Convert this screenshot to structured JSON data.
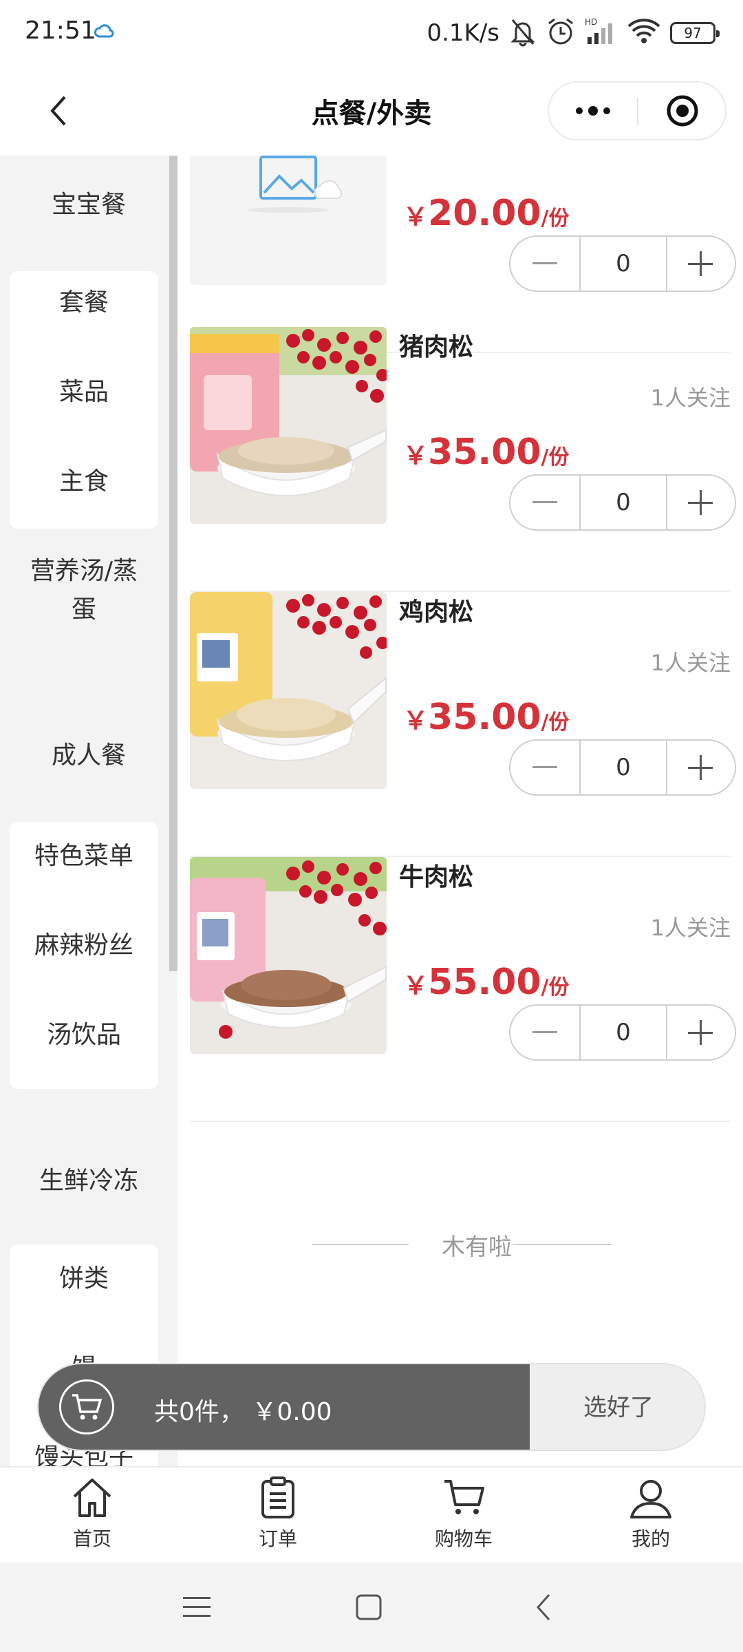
{
  "status_bar": {
    "time": "21:51",
    "net_speed": "0.1K/s",
    "battery": "97",
    "icons": [
      "cloud-sync-icon",
      "mute-bell-icon",
      "alarm-icon",
      "hd-signal-icon",
      "wifi-icon",
      "battery-icon"
    ]
  },
  "nav": {
    "title": "点餐/外卖",
    "back_icon": "chevron-left-icon",
    "more_icon": "more-dots-icon",
    "close_icon": "target-close-icon"
  },
  "sidebar": {
    "groups": [
      {
        "label": "宝宝餐",
        "items": [
          "套餐",
          "菜品",
          "主食",
          "营养汤/蒸蛋"
        ]
      },
      {
        "label": "成人餐",
        "items": [
          "特色菜单",
          "麻辣粉丝",
          "汤饮品"
        ]
      },
      {
        "label": "生鲜冷冻",
        "items": [
          "饼类",
          "馒",
          "馒头包子"
        ]
      }
    ]
  },
  "products": [
    {
      "name": "",
      "follow": "",
      "yen": "￥",
      "price": "20.00",
      "unit": "/份",
      "qty": "0",
      "image": "placeholder-image-icon"
    },
    {
      "name": "猪肉松",
      "follow": "1人关注",
      "yen": "￥",
      "price": "35.00",
      "unit": "/份",
      "qty": "0",
      "image": "pork-floss-photo"
    },
    {
      "name": "鸡肉松",
      "follow": "1人关注",
      "yen": "￥",
      "price": "35.00",
      "unit": "/份",
      "qty": "0",
      "image": "chicken-floss-photo"
    },
    {
      "name": "牛肉松",
      "follow": "1人关注",
      "yen": "￥",
      "price": "55.00",
      "unit": "/份",
      "qty": "0",
      "image": "beef-floss-photo"
    }
  ],
  "list_end": "木有啦",
  "cart": {
    "summary": "共0件， ￥0.00",
    "submit": "选好了",
    "icon": "cart-icon"
  },
  "tabs": [
    {
      "label": "首页",
      "icon": "home-icon"
    },
    {
      "label": "订单",
      "icon": "clipboard-icon"
    },
    {
      "label": "购物车",
      "icon": "cart-icon"
    },
    {
      "label": "我的",
      "icon": "user-icon"
    }
  ],
  "system_nav": [
    "menu-icon",
    "home-square-icon",
    "back-icon"
  ],
  "colors": {
    "price_red": "#d6323a",
    "cart_bar": "#626262",
    "sidebar_bg": "#f3f3f3"
  }
}
